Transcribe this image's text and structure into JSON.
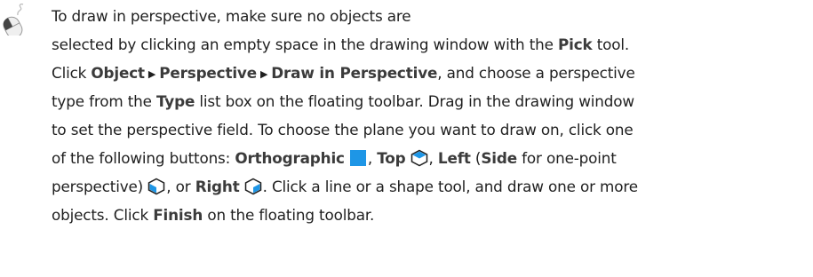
{
  "icons": {
    "mouse": "mouse-icon",
    "menu_arrow": "triangle-right-icon",
    "orthographic": "orthographic-plane-icon",
    "top": "top-plane-icon",
    "left": "left-plane-icon",
    "right": "right-plane-icon"
  },
  "colors": {
    "accent": "#1e96e6",
    "text": "#1f1f1f",
    "ui_term": "#3b3b3b"
  },
  "lines": [
    {
      "t1": "To draw in perspective, make sure no objects are"
    },
    {
      "t1": "selected by clicking an empty space in the drawing window with the ",
      "b1": "Pick",
      "t2": " tool."
    },
    {
      "t1": "Click ",
      "b1": "Object",
      "arrow1": "▶",
      "b2": "Perspective",
      "arrow2": "▶",
      "b3": "Draw in Perspective",
      "t2": ", and choose a perspective"
    },
    {
      "t1": "type from the ",
      "b1": "Type",
      "t2": " list box on the floating toolbar. Drag in the drawing window"
    },
    {
      "t1": "to set the perspective field. To choose the plane you want to draw on, click one"
    },
    {
      "t1": "of the following buttons: ",
      "b1": "Orthographic",
      "t2": ", ",
      "b2": "Top",
      "t3": ", ",
      "b3": "Left",
      "t4": " (",
      "b4": "Side",
      "t5": " for one-point"
    },
    {
      "t1": "perspective) ",
      "t2": ", or ",
      "b1": "Right",
      "t3": ". Click a line or a shape tool, and draw one or more"
    },
    {
      "t1": "objects. Click ",
      "b1": "Finish",
      "t2": " on the floating toolbar."
    }
  ]
}
